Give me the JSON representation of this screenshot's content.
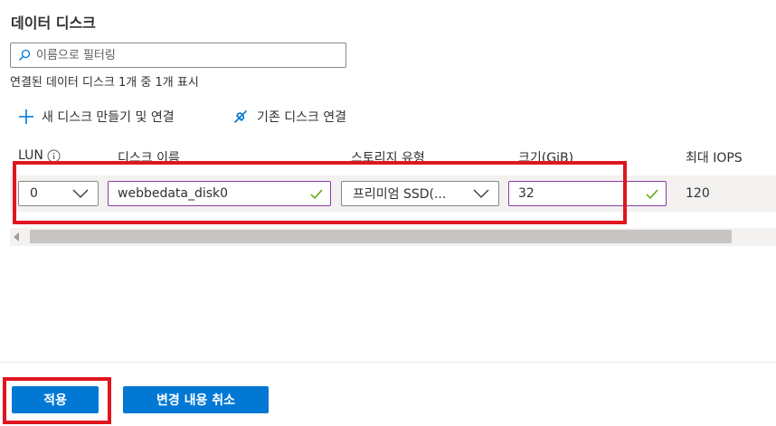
{
  "title": "데이터 디스크",
  "filter": {
    "placeholder": "이름으로 필터링",
    "value": ""
  },
  "count_text": "연결된 데이터 디스크 1개 중 1개 표시",
  "toolbar": {
    "new_disk": "새 디스크 만들기 및 연결",
    "attach_existing": "기존 디스크 연결"
  },
  "columns": {
    "lun": "LUN",
    "disk_name": "디스크 이름",
    "storage_type": "스토리지 유형",
    "size": "크기(GiB)",
    "max_iops": "최대 IOPS"
  },
  "rows": [
    {
      "lun": "0",
      "disk_name": "webbedata_disk0",
      "storage_type": "프리미엄 SSD(...",
      "size": "32",
      "max_iops": "120"
    }
  ],
  "footer": {
    "apply": "적용",
    "cancel": "변경 내용 취소"
  },
  "colors": {
    "accent": "#0078d4",
    "valid_check": "#57a300",
    "highlight": "#e0161f",
    "input_border_active": "#8a3ba6"
  }
}
